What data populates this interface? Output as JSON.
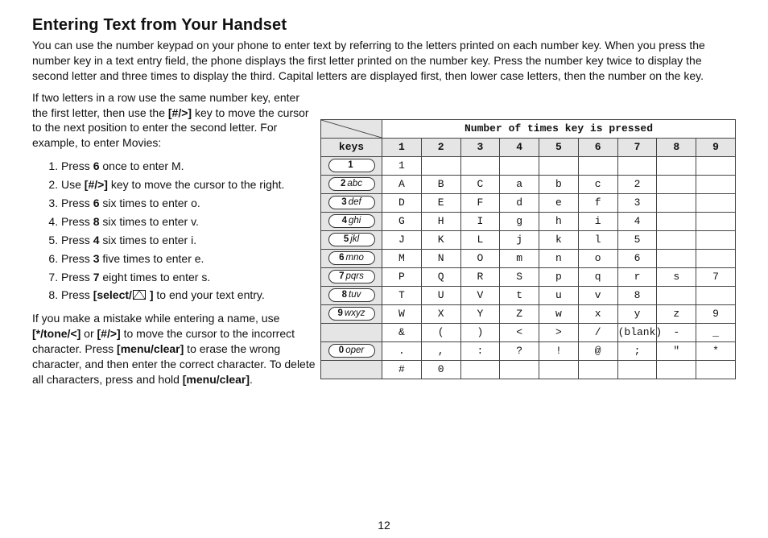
{
  "title": "Entering Text from Your Handset",
  "lead": "You can use the number keypad on your phone to enter text by referring to the letters printed on each number key. When you press the number key in a text entry field, the phone displays the first letter printed on the number key. Press the number key twice to display the second letter and three times to display the third. Capital letters are displayed first, then lower case letters, then the number on the key.",
  "left_intro_pre": "If two letters in a row use the same number key, enter the first letter, then use the ",
  "left_intro_mid": "[#/>]",
  "left_intro_post": " key to move the cursor to the next position to enter the second letter. For example, to enter Movies:",
  "steps": [
    {
      "pre": "Press ",
      "b": "6",
      "post": " once to enter M."
    },
    {
      "pre": "Use ",
      "b": "[#/>]",
      "post": " key to move the cursor to the right."
    },
    {
      "pre": "Press ",
      "b": "6",
      "post": " six times to enter o."
    },
    {
      "pre": "Press ",
      "b": "8",
      "post": " six times to enter v."
    },
    {
      "pre": "Press ",
      "b": "4",
      "post": " six times to enter i."
    },
    {
      "pre": "Press ",
      "b": "3",
      "post": " five times to enter e."
    },
    {
      "pre": "Press ",
      "b": "7",
      "post": " eight times to enter s."
    },
    {
      "pre": "Press ",
      "b": "[select/",
      "post": " to end your text entry.",
      "mail": true,
      "b2": " ]"
    }
  ],
  "mistake": {
    "p1": "If you make a mistake while entering a name, use ",
    "b1": "[*/tone/<]",
    "p2": " or ",
    "b2": "[#/>]",
    "p3": " to move the cursor to the incorrect character. Press ",
    "b3": "[menu/clear]",
    "p4": " to erase the wrong character, and then enter the correct character. To delete all characters, press and hold ",
    "b4": "[menu/clear]",
    "p5": "."
  },
  "table": {
    "header_span": "Number of times key is pressed",
    "keys_label": "keys",
    "cols": [
      "1",
      "2",
      "3",
      "4",
      "5",
      "6",
      "7",
      "8",
      "9"
    ]
  },
  "chart_data": {
    "type": "table",
    "title": "Multi-tap text entry — characters produced per key press",
    "columns": [
      "key",
      "1",
      "2",
      "3",
      "4",
      "5",
      "6",
      "7",
      "8",
      "9"
    ],
    "rows": [
      {
        "key": "1",
        "v": [
          "1",
          "",
          "",
          "",
          "",
          "",
          "",
          "",
          ""
        ]
      },
      {
        "key": "2 abc",
        "v": [
          "A",
          "B",
          "C",
          "a",
          "b",
          "c",
          "2",
          "",
          ""
        ]
      },
      {
        "key": "3 def",
        "v": [
          "D",
          "E",
          "F",
          "d",
          "e",
          "f",
          "3",
          "",
          ""
        ]
      },
      {
        "key": "4 ghi",
        "v": [
          "G",
          "H",
          "I",
          "g",
          "h",
          "i",
          "4",
          "",
          ""
        ]
      },
      {
        "key": "5 jkl",
        "v": [
          "J",
          "K",
          "L",
          "j",
          "k",
          "l",
          "5",
          "",
          ""
        ]
      },
      {
        "key": "6 mno",
        "v": [
          "M",
          "N",
          "O",
          "m",
          "n",
          "o",
          "6",
          "",
          ""
        ]
      },
      {
        "key": "7 pqrs",
        "v": [
          "P",
          "Q",
          "R",
          "S",
          "p",
          "q",
          "r",
          "s",
          "7"
        ]
      },
      {
        "key": "8 tuv",
        "v": [
          "T",
          "U",
          "V",
          "t",
          "u",
          "v",
          "8",
          "",
          ""
        ]
      },
      {
        "key": "9 wxyz",
        "v": [
          "W",
          "X",
          "Y",
          "Z",
          "w",
          "x",
          "y",
          "z",
          "9"
        ]
      },
      {
        "key": "",
        "v": [
          "&",
          "(",
          ")",
          "<",
          ">",
          "/",
          "(blank)",
          "-",
          "_"
        ]
      },
      {
        "key": "0 oper",
        "v": [
          ".",
          ",",
          ":",
          "?",
          "!",
          "@",
          ";",
          "\"",
          "*"
        ]
      },
      {
        "key": "",
        "v": [
          "#",
          "0",
          "",
          "",
          "",
          "",
          "",
          "",
          ""
        ]
      }
    ]
  },
  "pagenum": "12"
}
